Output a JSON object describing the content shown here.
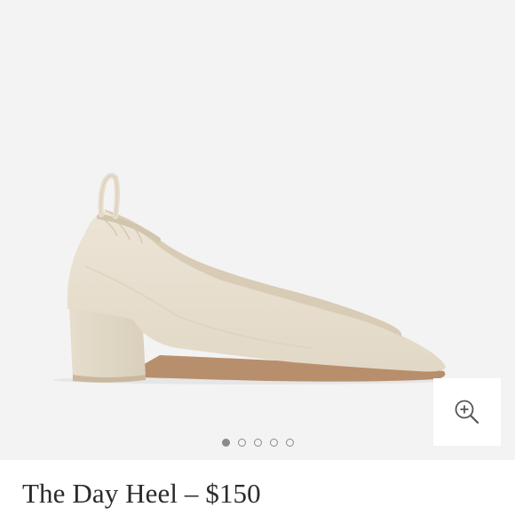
{
  "product": {
    "title": "The Day Heel – $150",
    "image_subject": "beige suede block-heel pump",
    "colors": {
      "gallery_background": "#f3f3f3",
      "shoe_suede": "#e8dfd0",
      "sole": "#b88f6c",
      "title_text": "#2b2b2b",
      "dot": "#8a8a8a"
    }
  },
  "gallery": {
    "zoom_icon": "zoom-in-icon",
    "total_images": 5,
    "active_index": 0
  }
}
